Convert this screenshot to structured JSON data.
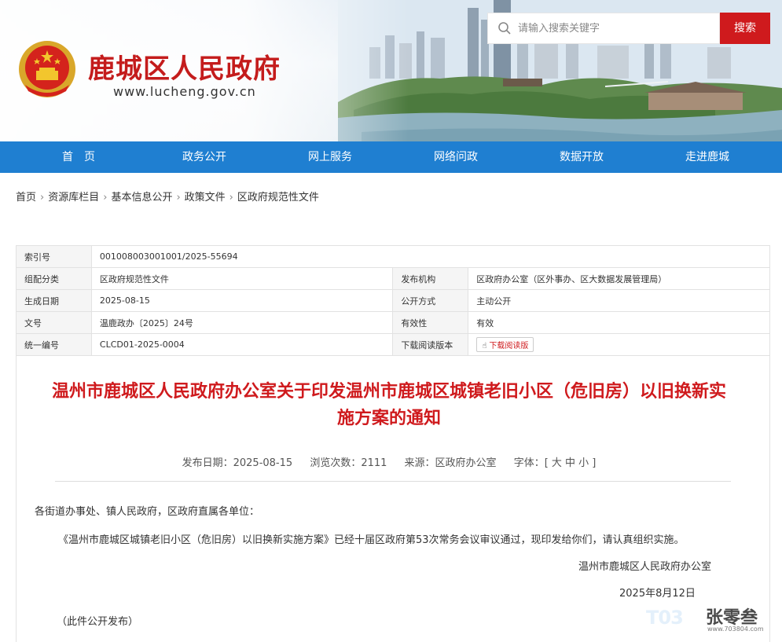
{
  "header": {
    "site_name": "鹿城区人民政府",
    "site_url": "www.lucheng.gov.cn",
    "search": {
      "placeholder": "请输入搜索关键字",
      "button_label": "搜索"
    }
  },
  "nav": {
    "items": [
      "首　页",
      "政务公开",
      "网上服务",
      "网络问政",
      "数据开放",
      "走进鹿城"
    ]
  },
  "breadcrumb": [
    "首页",
    "资源库栏目",
    "基本信息公开",
    "政策文件",
    "区政府规范性文件"
  ],
  "info": {
    "index_label": "索引号",
    "index_value": "001008003001001/2025-55694",
    "category_label": "组配分类",
    "category_value": "区政府规范性文件",
    "publisher_label": "发布机构",
    "publisher_value": "区政府办公室（区外事办、区大数据发展管理局）",
    "created_label": "生成日期",
    "created_value": "2025-08-15",
    "method_label": "公开方式",
    "method_value": "主动公开",
    "doc_label": "文号",
    "doc_value": "温鹿政办〔2025〕24号",
    "validity_label": "有效性",
    "validity_value": "有效",
    "serial_label": "统一编号",
    "serial_value": "CLCD01-2025-0004",
    "download_label": "下载阅读版本",
    "download_button": "下载阅读版"
  },
  "article": {
    "title": "温州市鹿城区人民政府办公室关于印发温州市鹿城区城镇老旧小区（危旧房）以旧换新实施方案的通知",
    "meta": {
      "date": "发布日期：2025-08-15",
      "views": "浏览次数：2111",
      "source": "来源：区政府办公室",
      "font": "字体：[ 大 中 小 ]"
    },
    "salutation": "各街道办事处、镇人民政府，区政府直属各单位：",
    "body": "《温州市鹿城区城镇老旧小区（危旧房）以旧换新实施方案》已经十届区政府第53次常务会议审议通过，现印发给你们，请认真组织实施。",
    "signature": "温州市鹿城区人民政府办公室",
    "date_signed": "2025年8月12日",
    "note": "（此件公开发布）"
  },
  "watermark": {
    "logo": "T03",
    "name": "张零叁",
    "url": "www.703804.com"
  },
  "colors": {
    "brand_red": "#cf1a1d",
    "nav_blue": "#1f7fd1"
  }
}
